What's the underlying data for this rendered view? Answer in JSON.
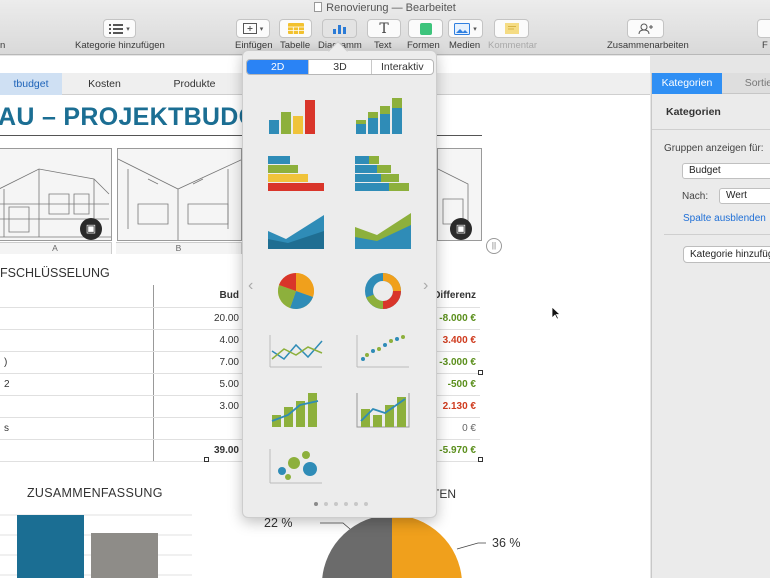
{
  "window": {
    "title": "Renovierung — Bearbeitet"
  },
  "toolbar": {
    "left_label": "n",
    "category_add": "Kategorie hinzufügen",
    "insert": "Einfügen",
    "table": "Tabelle",
    "chart": "Diagramm",
    "text": "Text",
    "shapes": "Formen",
    "media": "Medien",
    "comment": "Kommentar",
    "collaborate": "Zusammenarbeiten",
    "right_label": "F"
  },
  "sheet_tabs": [
    "tbudget",
    "Kosten",
    "Produkte"
  ],
  "page": {
    "title": "AU – PROJEKTBUDGET"
  },
  "photo_columns": [
    "A",
    "B"
  ],
  "table": {
    "caption": "FSCHLÜSSELUNG",
    "header_budget": "Bud",
    "header_diff": "Differenz",
    "rows": [
      {
        "label": "",
        "budget": "20.00",
        "diff": "-8.000 €",
        "tone": "pos"
      },
      {
        "label": "",
        "budget": "4.00",
        "diff": "3.400 €",
        "tone": "neg"
      },
      {
        "label": ")",
        "budget": "7.00",
        "diff": "-3.000 €",
        "tone": "pos"
      },
      {
        "label": "2",
        "budget": "5.00",
        "diff": "-500 €",
        "tone": "pos"
      },
      {
        "label": "",
        "budget": "3.00",
        "diff": "2.130 €",
        "tone": "neg"
      },
      {
        "label": "s",
        "budget": "",
        "diff": "0 €",
        "tone": "neu"
      }
    ],
    "total_budget": "39.00",
    "total_diff": "-5.970 €"
  },
  "summary": {
    "title": "ZUSAMMENFASSUNG",
    "costs_title_fragment": "TEN",
    "pie_labels": [
      "22 %",
      "36 %"
    ]
  },
  "popover": {
    "tabs": [
      "2D",
      "3D",
      "Interaktiv"
    ],
    "active_tab": "2D",
    "chart_types": [
      "column-chart-icon",
      "stacked-column-chart-icon",
      "bar-chart-icon",
      "stacked-bar-chart-icon",
      "area-chart-icon",
      "stacked-area-chart-icon",
      "pie-chart-icon",
      "donut-chart-icon",
      "line-chart-icon",
      "scatter-chart-icon",
      "mixed-chart-icon",
      "two-axis-chart-icon",
      "bubble-chart-icon"
    ],
    "page_count": 6,
    "active_page": 1
  },
  "sidebar": {
    "tabs": [
      "Kategorien",
      "Sortieren"
    ],
    "heading": "Kategorien",
    "group_label": "Gruppen anzeigen für:",
    "group_value": "Budget",
    "by_label": "Nach:",
    "by_value": "Wert",
    "hide_link": "Spalte ausblenden",
    "add_button": "Kategorie hinzufügen"
  },
  "colors": {
    "title_teal": "#1b6e93",
    "teal": "#1b6e93",
    "gray": "#8e8c88",
    "orange": "#f0a01c",
    "green": "#8db03c",
    "red": "#d9352a",
    "yellow": "#f0c33a",
    "blue": "#2a83f5"
  }
}
